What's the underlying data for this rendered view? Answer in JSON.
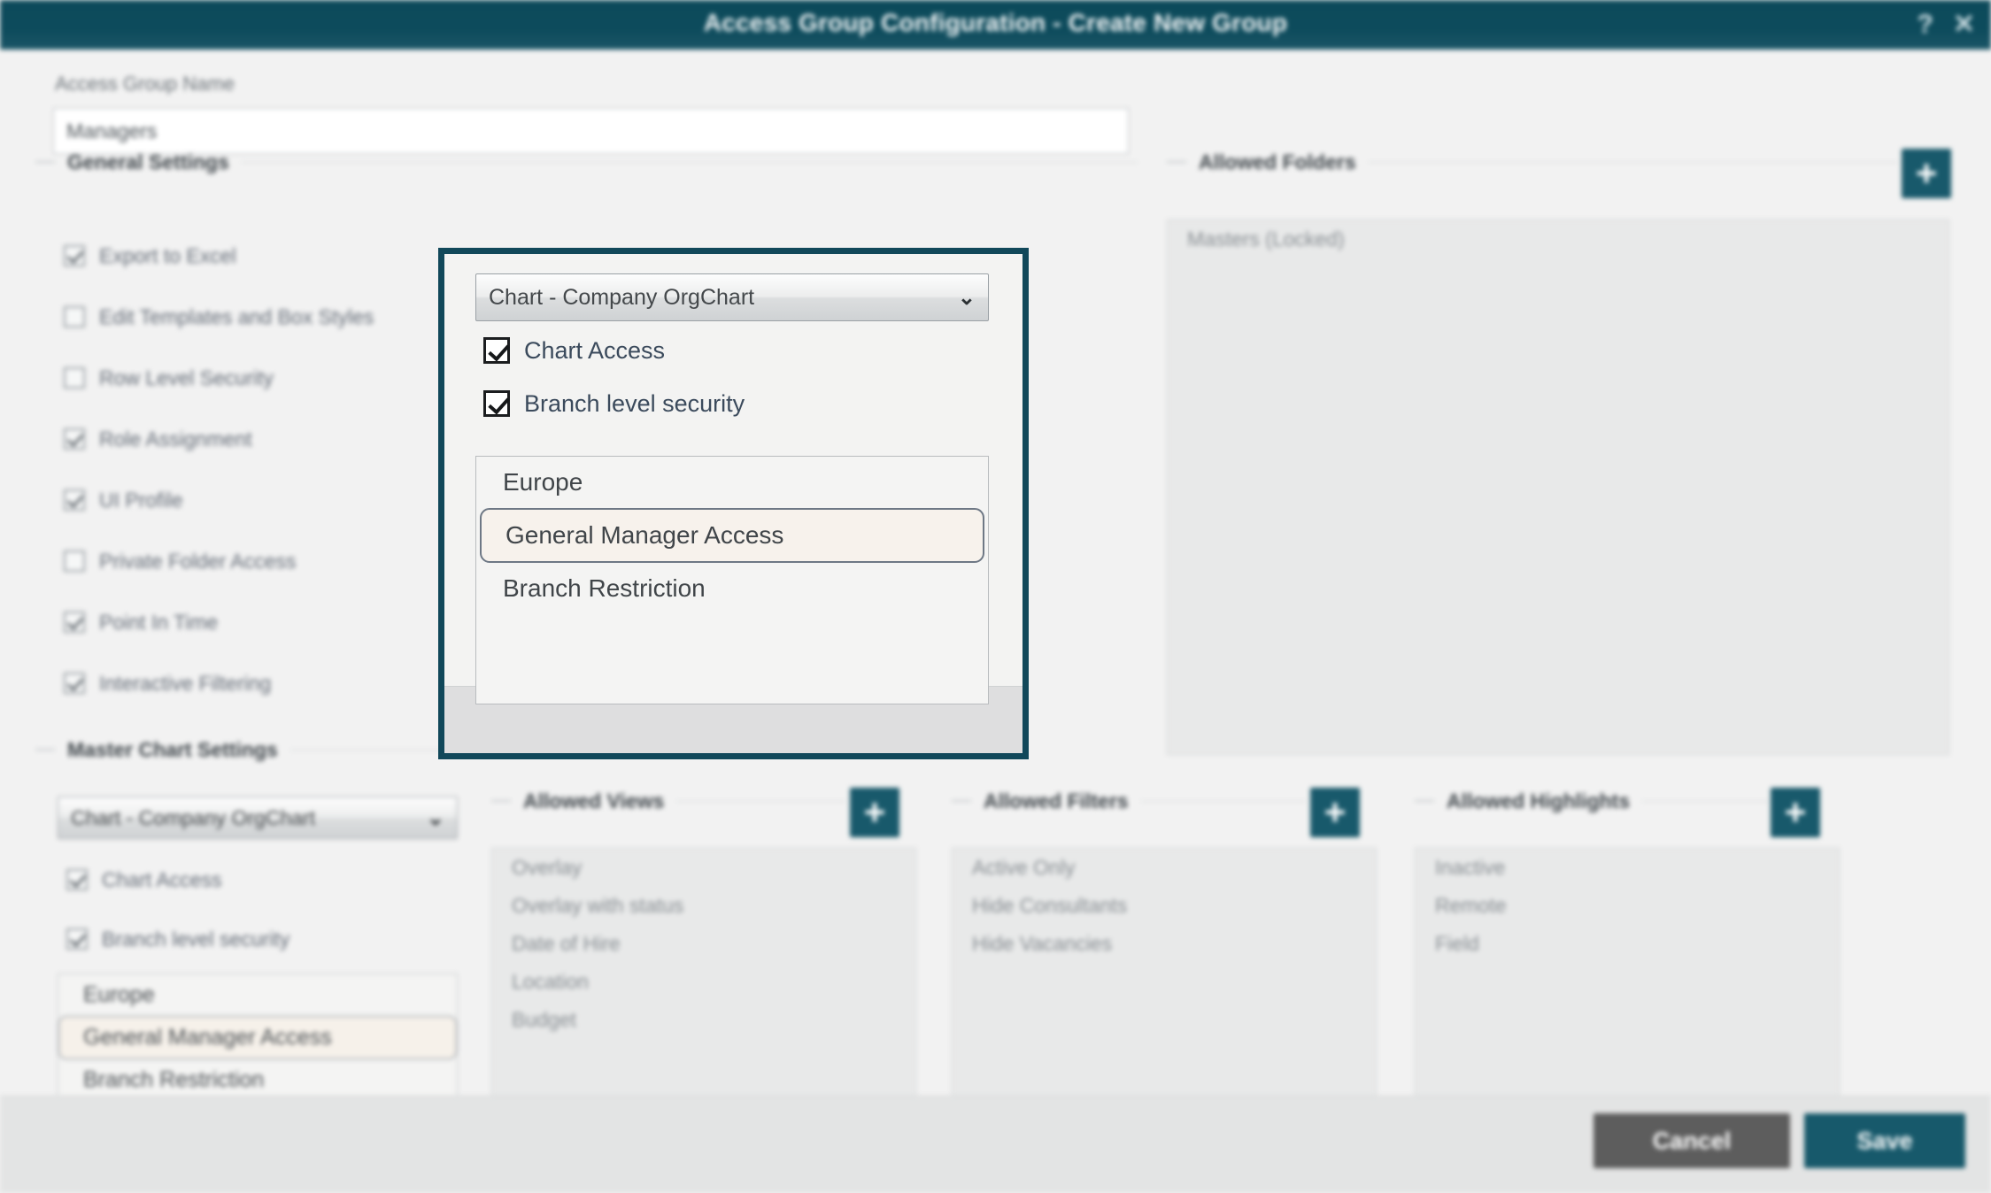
{
  "window": {
    "title": "Access Group Configuration - Create New Group",
    "help_icon": "?",
    "close_icon": "✕"
  },
  "form": {
    "name_label": "Access Group Name",
    "name_value": "Managers",
    "name_placeholder": "Access Group Name"
  },
  "general_settings": {
    "heading": "General Settings",
    "items": [
      {
        "label": "Export to Excel",
        "checked": true
      },
      {
        "label": "Edit Templates and Box Styles",
        "checked": false
      },
      {
        "label": "Row Level Security",
        "checked": false
      },
      {
        "label": "Role Assignment",
        "checked": true
      },
      {
        "label": "UI Profile",
        "checked": true
      },
      {
        "label": "Private Folder Access",
        "checked": false
      },
      {
        "label": "Point In Time",
        "checked": true
      },
      {
        "label": "Interactive Filtering",
        "checked": true
      }
    ]
  },
  "master_chart_settings": {
    "heading": "Master Chart Settings",
    "chart_select_value": "Chart - Company OrgChart",
    "chart_access": {
      "label": "Chart Access",
      "checked": true
    },
    "branch_security": {
      "label": "Branch level security",
      "checked": true
    },
    "branch_list": [
      {
        "label": "Europe",
        "selected": false
      },
      {
        "label": "General Manager Access",
        "selected": true
      },
      {
        "label": "Branch Restriction",
        "selected": false
      }
    ]
  },
  "popup": {
    "chart_select_value": "Chart - Company OrgChart",
    "dropdown_arrow": "⌄",
    "chart_access": {
      "label": "Chart Access",
      "checked": true
    },
    "branch_security": {
      "label": "Branch level security",
      "checked": true
    },
    "branch_list": [
      {
        "label": "Europe",
        "selected": false
      },
      {
        "label": "General Manager Access",
        "selected": true
      },
      {
        "label": "Branch Restriction",
        "selected": false
      }
    ]
  },
  "allowed_folders": {
    "heading": "Allowed Folders",
    "add_icon": "+",
    "items": [
      "Masters (Locked)"
    ]
  },
  "allowed_views": {
    "heading": "Allowed Views",
    "add_icon": "+",
    "items": [
      "Overlay",
      "Overlay with status",
      "Date of Hire",
      "Location",
      "Budget"
    ]
  },
  "allowed_filters": {
    "heading": "Allowed Filters",
    "add_icon": "+",
    "items": [
      "Active Only",
      "Hide Consultants",
      "Hide Vacancies"
    ]
  },
  "allowed_highlights": {
    "heading": "Allowed Highlights",
    "add_icon": "+",
    "items": [
      "Inactive",
      "Remote",
      "Field"
    ]
  },
  "footer": {
    "cancel_label": "Cancel",
    "save_label": "Save"
  },
  "colors": {
    "brand_teal": "#17596b",
    "titlebar": "#0d4b5c",
    "popup_border": "#11485a",
    "cancel_gray": "#5d5d5d",
    "selected_row": "#f7f2ec"
  }
}
